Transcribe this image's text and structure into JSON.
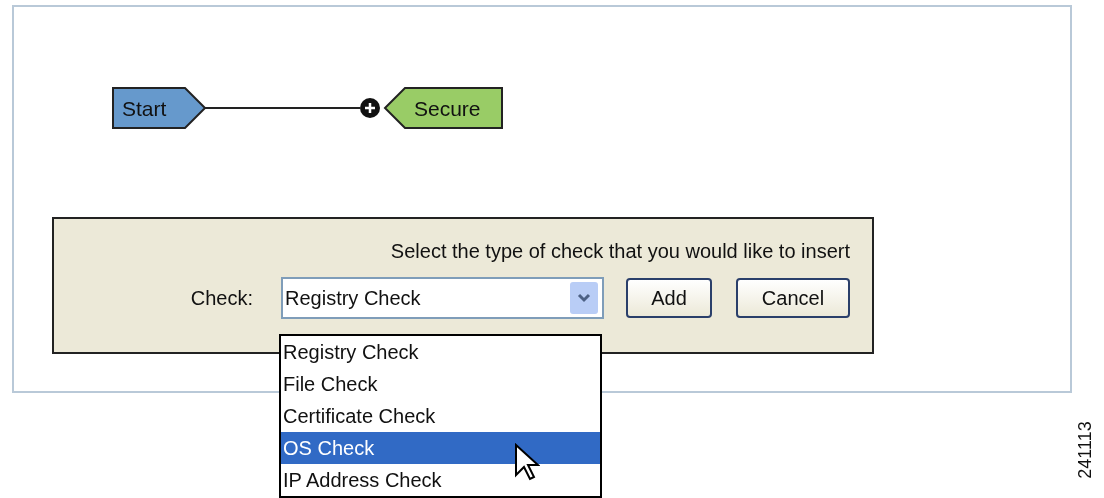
{
  "diagram": {
    "nodes": [
      {
        "kind": "start",
        "label": "Start"
      },
      {
        "kind": "end",
        "label": "Secure"
      }
    ]
  },
  "insert_panel": {
    "prompt": "Select the type of check that you would like to insert",
    "check_label": "Check:",
    "check_select": {
      "value": "Registry Check",
      "expanded": true,
      "options": [
        {
          "label": "Registry Check",
          "highlighted": false
        },
        {
          "label": "File Check",
          "highlighted": false
        },
        {
          "label": "Certificate Check",
          "highlighted": false
        },
        {
          "label": "OS Check",
          "highlighted": true
        },
        {
          "label": "IP Address Check",
          "highlighted": false
        }
      ]
    },
    "buttons": [
      "Add",
      "Cancel"
    ]
  },
  "figure_id": "241113"
}
